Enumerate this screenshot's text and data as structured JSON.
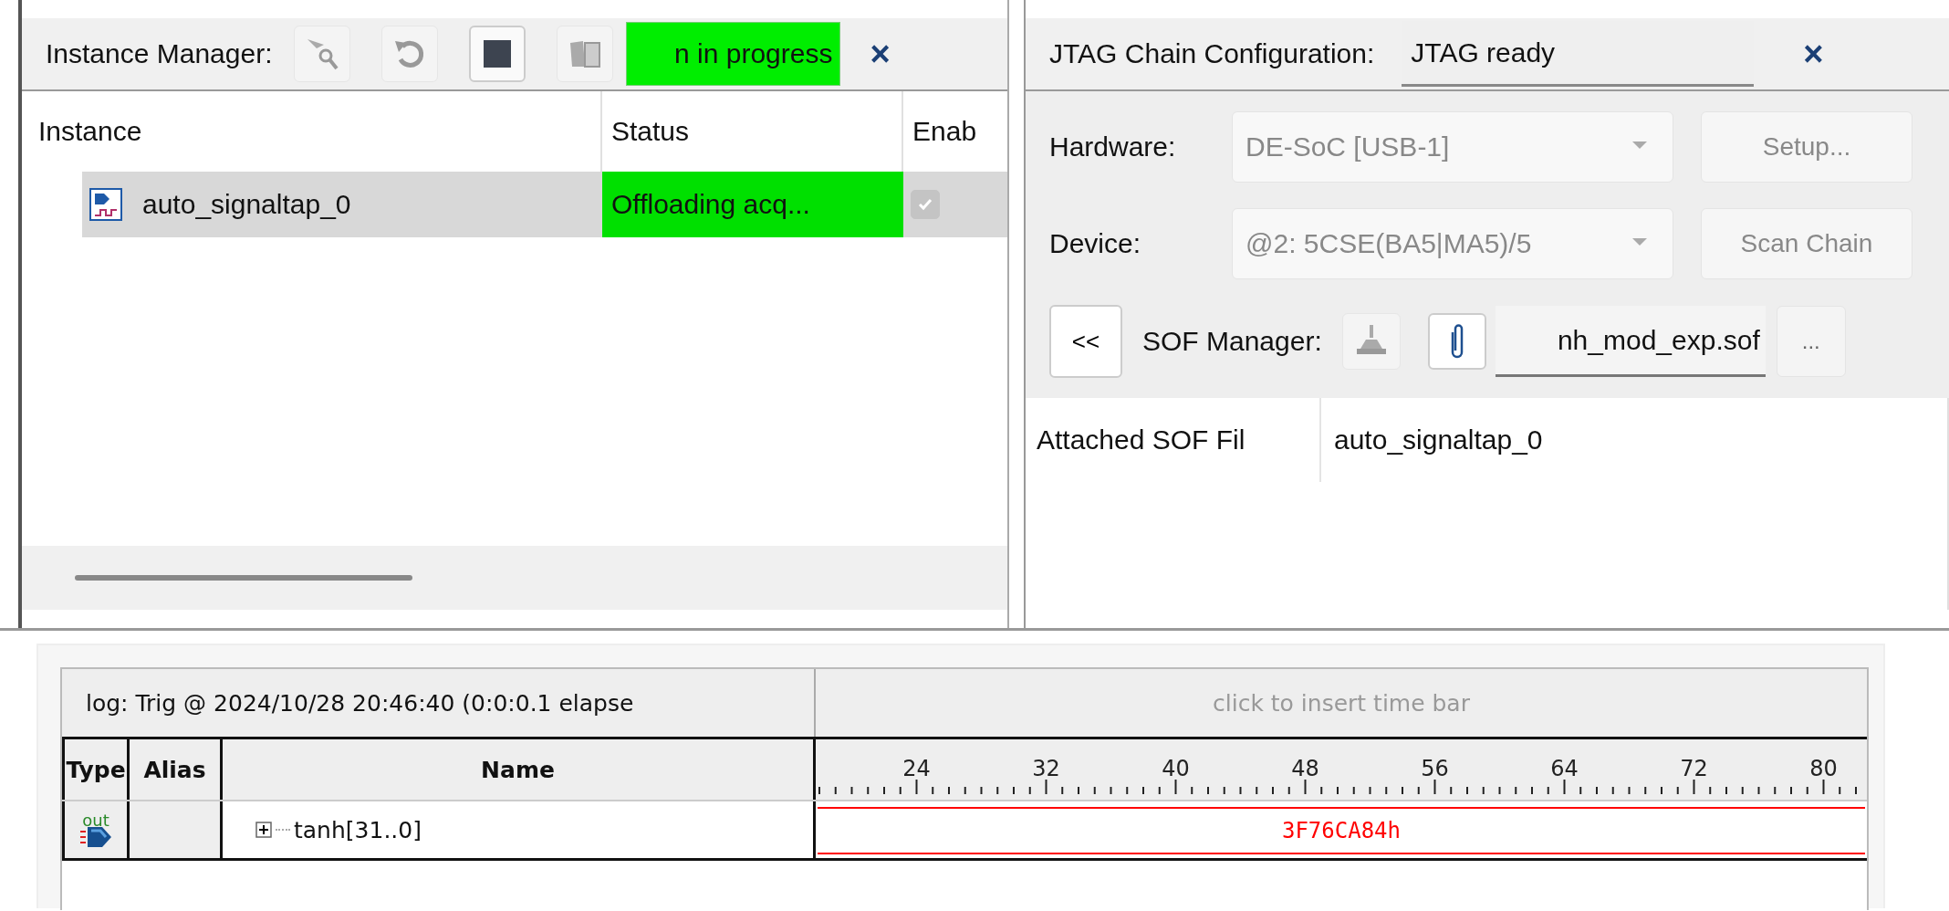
{
  "instance_manager": {
    "title": "Instance Manager:",
    "status": "n in progress",
    "close": "×",
    "columns": [
      "Instance",
      "Status",
      "Enab"
    ],
    "rows": [
      {
        "instance": "auto_signaltap_0",
        "status": "Offloading acq...",
        "enabled": true,
        "selected": true
      }
    ]
  },
  "jtag": {
    "title": "JTAG Chain Configuration:",
    "status": "JTAG ready",
    "close": "×",
    "hardware_label": "Hardware:",
    "hardware": "DE-SoC [USB-1]",
    "setup": "Setup...",
    "device_label": "Device:",
    "device": "@2: 5CSE(BA5|MA5)/5",
    "scan": "Scan Chain",
    "collapse": "<<",
    "sof_label": "SOF Manager:",
    "sof_file": "nh_mod_exp.sof",
    "browse": "...",
    "attached": {
      "label": "Attached SOF Fil",
      "value": "auto_signaltap_0"
    }
  },
  "waveform": {
    "log": "log: Trig @ 2024/10/28 20:46:40 (0:0:0.1 elapse",
    "time_bar": "click to insert time bar",
    "columns": [
      "Type",
      "Alias",
      "Name"
    ],
    "ticks": [
      "24",
      "32",
      "40",
      "48",
      "56",
      "64",
      "72",
      "80"
    ],
    "signals": [
      {
        "type": "out",
        "name": "tanh[31..0]",
        "value": "3F76CA84h",
        "expandable": true
      }
    ]
  }
}
